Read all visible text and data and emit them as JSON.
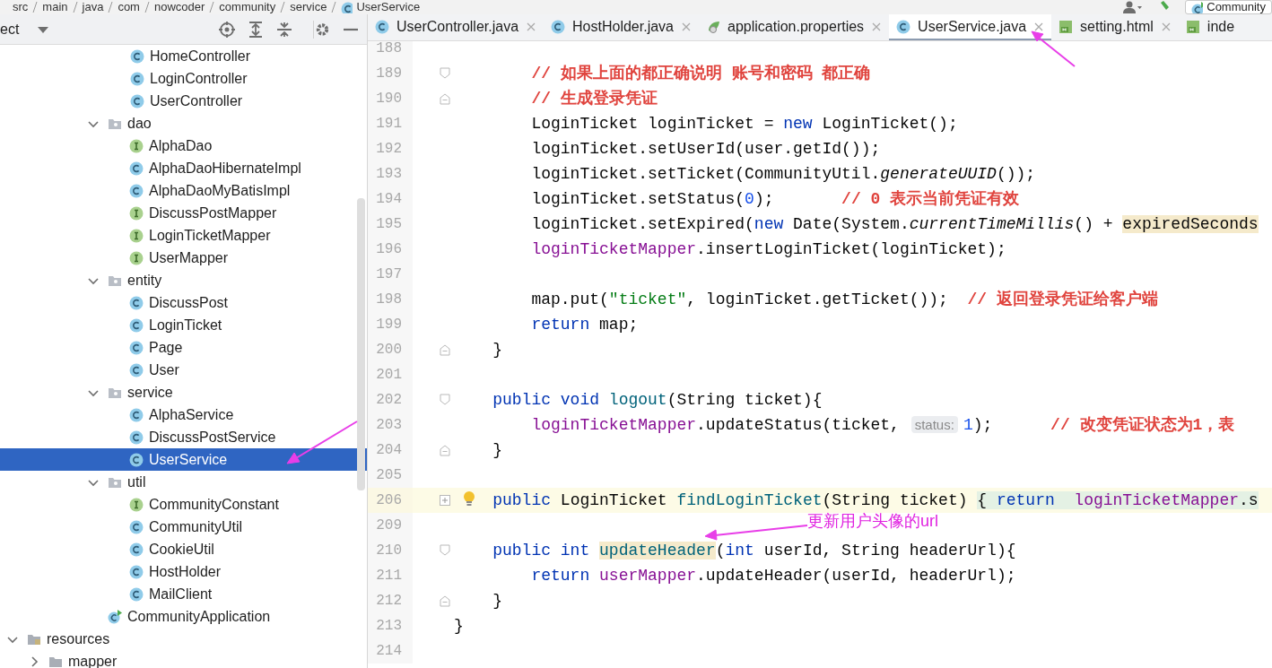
{
  "breadcrumb": [
    "src",
    "main",
    "java",
    "com",
    "nowcoder",
    "community",
    "service",
    "UserService"
  ],
  "run_config": "Community",
  "project_panel": {
    "title": "ect"
  },
  "tree": [
    {
      "label": "HomeController",
      "kind": "class",
      "selected": false
    },
    {
      "label": "LoginController",
      "kind": "class",
      "selected": false
    },
    {
      "label": "UserController",
      "kind": "class",
      "selected": false
    },
    {
      "label": "dao",
      "kind": "package",
      "expanded": true,
      "selected": false,
      "children": [
        {
          "label": "AlphaDao",
          "kind": "interface",
          "selected": false
        },
        {
          "label": "AlphaDaoHibernateImpl",
          "kind": "class",
          "selected": false
        },
        {
          "label": "AlphaDaoMyBatisImpl",
          "kind": "class",
          "selected": false
        },
        {
          "label": "DiscussPostMapper",
          "kind": "interface",
          "selected": false
        },
        {
          "label": "LoginTicketMapper",
          "kind": "interface",
          "selected": false
        },
        {
          "label": "UserMapper",
          "kind": "interface",
          "selected": false
        }
      ]
    },
    {
      "label": "entity",
      "kind": "package",
      "expanded": true,
      "selected": false,
      "children": [
        {
          "label": "DiscussPost",
          "kind": "class",
          "selected": false
        },
        {
          "label": "LoginTicket",
          "kind": "class",
          "selected": false
        },
        {
          "label": "Page",
          "kind": "class",
          "selected": false
        },
        {
          "label": "User",
          "kind": "class",
          "selected": false
        }
      ]
    },
    {
      "label": "service",
      "kind": "package",
      "expanded": true,
      "selected": false,
      "children": [
        {
          "label": "AlphaService",
          "kind": "class",
          "selected": false
        },
        {
          "label": "DiscussPostService",
          "kind": "class",
          "selected": false
        },
        {
          "label": "UserService",
          "kind": "class",
          "selected": true
        }
      ]
    },
    {
      "label": "util",
      "kind": "package",
      "expanded": true,
      "selected": false,
      "children": [
        {
          "label": "CommunityConstant",
          "kind": "interface",
          "selected": false
        },
        {
          "label": "CommunityUtil",
          "kind": "class",
          "selected": false
        },
        {
          "label": "CookieUtil",
          "kind": "class",
          "selected": false
        },
        {
          "label": "HostHolder",
          "kind": "class",
          "selected": false
        },
        {
          "label": "MailClient",
          "kind": "class",
          "selected": false
        }
      ]
    },
    {
      "label": "CommunityApplication",
      "kind": "app",
      "selected": false
    },
    {
      "label": "resources",
      "kind": "resources",
      "expanded": true,
      "selected": false,
      "children": [
        {
          "label": "mapper",
          "kind": "folder",
          "expanded": false,
          "selected": false
        }
      ]
    }
  ],
  "tabs": [
    {
      "label": "UserController.java",
      "kind": "class",
      "selected": false
    },
    {
      "label": "HostHolder.java",
      "kind": "class",
      "selected": false
    },
    {
      "label": "application.properties",
      "kind": "properties",
      "selected": false
    },
    {
      "label": "UserService.java",
      "kind": "class",
      "selected": true
    },
    {
      "label": "setting.html",
      "kind": "html",
      "selected": false
    },
    {
      "label": "inde",
      "kind": "html",
      "selected": false
    }
  ],
  "code_lines": [
    {
      "number": "188",
      "current": false
    },
    {
      "number": "189",
      "current": false,
      "gutter_mark": {
        "kind": "fold_start"
      },
      "tokens": [
        {
          "kind": "comment",
          "text": "        // 如果上面的都正确说明 账号和密码 都正确"
        }
      ]
    },
    {
      "number": "190",
      "current": false,
      "gutter_mark": {
        "kind": "fold_end"
      },
      "tokens": [
        {
          "kind": "comment",
          "text": "        // 生成登录凭证"
        }
      ]
    },
    {
      "number": "191",
      "current": false,
      "tokens": [
        {
          "kind": "plain",
          "text": "        LoginTicket loginTicket = "
        },
        {
          "kind": "keyword",
          "text": "new"
        },
        {
          "kind": "plain",
          "text": " LoginTicket();"
        }
      ]
    },
    {
      "number": "192",
      "current": false,
      "tokens": [
        {
          "kind": "plain",
          "text": "        loginTicket.setUserId(user.getId());"
        }
      ]
    },
    {
      "number": "193",
      "current": false,
      "tokens": [
        {
          "kind": "plain",
          "text": "        loginTicket.setTicket(CommunityUtil."
        },
        {
          "kind": "static",
          "text": "generateUUID"
        },
        {
          "kind": "plain",
          "text": "());"
        }
      ]
    },
    {
      "number": "194",
      "current": false,
      "tokens": [
        {
          "kind": "plain",
          "text": "        loginTicket.setStatus("
        },
        {
          "kind": "number",
          "text": "0"
        },
        {
          "kind": "plain",
          "text": ");       "
        },
        {
          "kind": "comment",
          "text": "// 0 表示当前凭证有效"
        }
      ]
    },
    {
      "number": "195",
      "current": false,
      "tokens": [
        {
          "kind": "plain",
          "text": "        loginTicket.setExpired("
        },
        {
          "kind": "keyword",
          "text": "new"
        },
        {
          "kind": "plain",
          "text": " Date(System."
        },
        {
          "kind": "static",
          "text": "currentTimeMillis"
        },
        {
          "kind": "plain",
          "text": "() + "
        },
        {
          "kind": "match",
          "text": "expiredSeconds"
        }
      ]
    },
    {
      "number": "196",
      "current": false,
      "tokens": [
        {
          "kind": "field",
          "text": "        loginTicketMapper"
        },
        {
          "kind": "plain",
          "text": ".insertLoginTicket(loginTicket);"
        }
      ]
    },
    {
      "number": "197",
      "current": false
    },
    {
      "number": "198",
      "current": false,
      "tokens": [
        {
          "kind": "plain",
          "text": "        map.put("
        },
        {
          "kind": "string",
          "text": "\"ticket\""
        },
        {
          "kind": "plain",
          "text": ", loginTicket.getTicket());  "
        },
        {
          "kind": "comment",
          "text": "// 返回登录凭证给客户端"
        }
      ]
    },
    {
      "number": "199",
      "current": false,
      "tokens": [
        {
          "kind": "keyword",
          "text": "        return"
        },
        {
          "kind": "plain",
          "text": " map;"
        }
      ]
    },
    {
      "number": "200",
      "current": false,
      "gutter_mark": {
        "kind": "fold_end"
      },
      "tokens": [
        {
          "kind": "plain",
          "text": "    }"
        }
      ]
    },
    {
      "number": "201",
      "current": false
    },
    {
      "number": "202",
      "current": false,
      "gutter_mark": {
        "kind": "fold_start"
      },
      "tokens": [
        {
          "kind": "keyword",
          "text": "    public void "
        },
        {
          "kind": "decl",
          "text": "logout"
        },
        {
          "kind": "plain",
          "text": "(String ticket){"
        }
      ]
    },
    {
      "number": "203",
      "current": false,
      "tokens": [
        {
          "kind": "field",
          "text": "        loginTicketMapper"
        },
        {
          "kind": "plain",
          "text": ".updateStatus(ticket, "
        },
        {
          "kind": "hint",
          "text": "status:"
        },
        {
          "kind": "number",
          "text": "1"
        },
        {
          "kind": "plain",
          "text": ");      "
        },
        {
          "kind": "comment",
          "text": "// 改变凭证状态为1，表"
        }
      ]
    },
    {
      "number": "204",
      "current": false,
      "gutter_mark": {
        "kind": "fold_end"
      },
      "tokens": [
        {
          "kind": "plain",
          "text": "    }"
        }
      ]
    },
    {
      "number": "205",
      "current": false
    },
    {
      "number": "206",
      "current": true,
      "gutter_mark": {
        "kind": "fold_collapsed"
      },
      "bulb": true,
      "tokens": [
        {
          "kind": "keyword",
          "text": "    public"
        },
        {
          "kind": "plain",
          "text": " LoginTicket "
        },
        {
          "kind": "decl",
          "text": "findLoginTicket"
        },
        {
          "kind": "plain",
          "text": "(String ticket) "
        },
        {
          "kind": "folded_plain",
          "text": "{ "
        },
        {
          "kind": "folded_keyword",
          "text": "return  "
        },
        {
          "kind": "folded_field",
          "text": "loginTicketMapper"
        },
        {
          "kind": "folded_plain",
          "text": ".s"
        }
      ]
    },
    {
      "number": "209",
      "current": false
    },
    {
      "number": "210",
      "current": false,
      "gutter_mark": {
        "kind": "fold_start"
      },
      "tokens": [
        {
          "kind": "keyword",
          "text": "    public int "
        },
        {
          "kind": "decl_match",
          "text": "updateHeader"
        },
        {
          "kind": "plain",
          "text": "("
        },
        {
          "kind": "keyword",
          "text": "int"
        },
        {
          "kind": "plain",
          "text": " userId, String headerUrl){"
        }
      ]
    },
    {
      "number": "211",
      "current": false,
      "tokens": [
        {
          "kind": "keyword",
          "text": "        return "
        },
        {
          "kind": "field",
          "text": "userMapper"
        },
        {
          "kind": "plain",
          "text": ".updateHeader(userId, headerUrl);"
        }
      ]
    },
    {
      "number": "212",
      "current": false,
      "gutter_mark": {
        "kind": "fold_end"
      },
      "tokens": [
        {
          "kind": "plain",
          "text": "    }"
        }
      ]
    },
    {
      "number": "213",
      "current": false,
      "tokens": [
        {
          "kind": "plain",
          "text": "}"
        }
      ]
    },
    {
      "number": "214",
      "current": false
    }
  ],
  "annotation": "更新用户头像的url"
}
